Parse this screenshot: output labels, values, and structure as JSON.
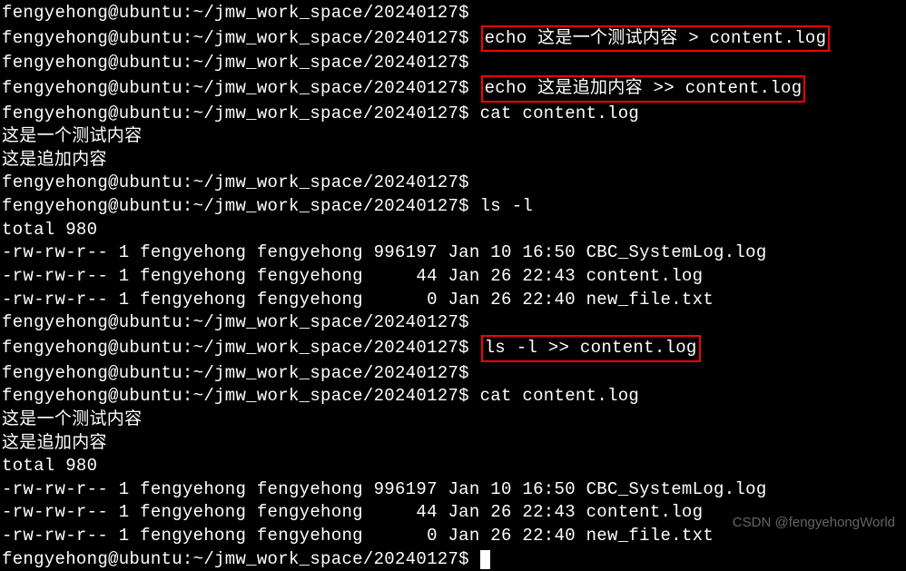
{
  "prompt": "fengyehong@ubuntu:~/jmw_work_space/20240127$",
  "cmd1": "echo 这是一个测试内容 > content.log",
  "cmd2": "echo 这是追加内容 >> content.log",
  "cmd3": "cat content.log",
  "out_cat1_line1": "这是一个测试内容",
  "out_cat1_line2": "这是追加内容",
  "cmd4": "ls -l",
  "out_ls_total": "total 980",
  "out_ls_f1": "-rw-rw-r-- 1 fengyehong fengyehong 996197 Jan 10 16:50 CBC_SystemLog.log",
  "out_ls_f2": "-rw-rw-r-- 1 fengyehong fengyehong     44 Jan 26 22:43 content.log",
  "out_ls_f3": "-rw-rw-r-- 1 fengyehong fengyehong      0 Jan 26 22:40 new_file.txt",
  "cmd5": "ls -l >> content.log",
  "cmd6": "cat content.log",
  "out_cat2_line1": "这是一个测试内容",
  "out_cat2_line2": "这是追加内容",
  "out_cat2_total": "total 980",
  "out_cat2_f1": "-rw-rw-r-- 1 fengyehong fengyehong 996197 Jan 10 16:50 CBC_SystemLog.log",
  "out_cat2_f2": "-rw-rw-r-- 1 fengyehong fengyehong     44 Jan 26 22:43 content.log",
  "out_cat2_f3": "-rw-rw-r-- 1 fengyehong fengyehong      0 Jan 26 22:40 new_file.txt",
  "watermark": "CSDN @fengyehongWorld"
}
